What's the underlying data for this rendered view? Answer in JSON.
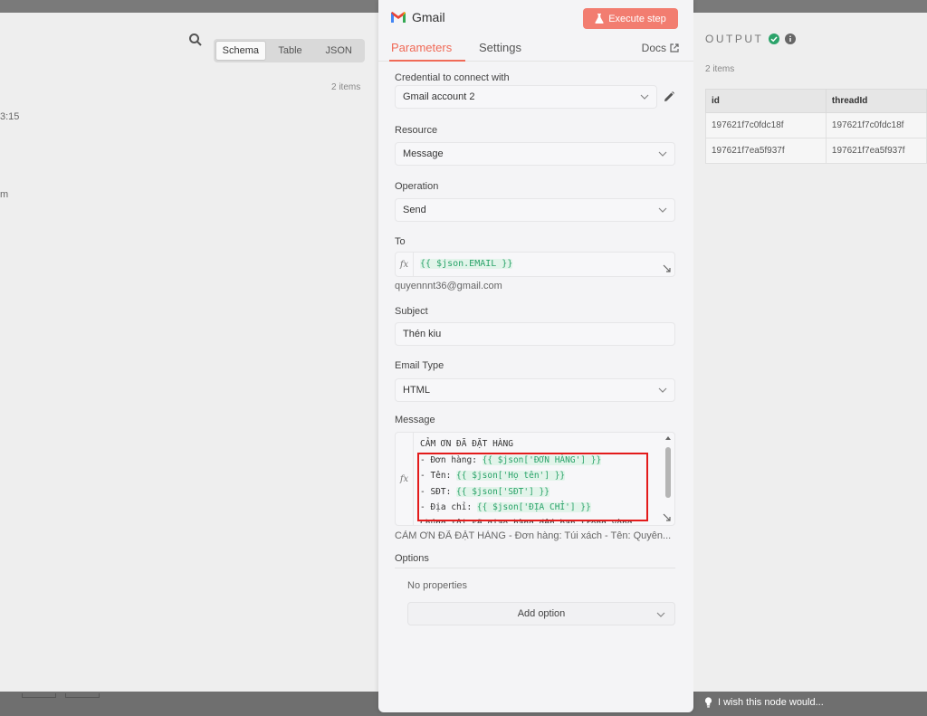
{
  "left_panel": {
    "view_tabs": [
      "Schema",
      "Table",
      "JSON"
    ],
    "active_view": "Schema",
    "item_count": "2 items",
    "fragment_1": "3:15",
    "fragment_2": "m"
  },
  "node": {
    "title": "Gmail",
    "icon": "gmail-icon",
    "execute_label": "Execute step",
    "tabs": {
      "parameters": "Parameters",
      "settings": "Settings"
    },
    "docs_label": "Docs",
    "accent_color": "#f06a57"
  },
  "params": {
    "credential": {
      "label": "Credential to connect with",
      "value": "Gmail account 2"
    },
    "resource": {
      "label": "Resource",
      "value": "Message"
    },
    "operation": {
      "label": "Operation",
      "value": "Send"
    },
    "to": {
      "label": "To",
      "expression": "{{ $json.EMAIL }}",
      "preview": "quyennnt36@gmail.com"
    },
    "subject": {
      "label": "Subject",
      "value": "Thén kiu"
    },
    "email_type": {
      "label": "Email Type",
      "value": "HTML"
    },
    "message": {
      "label": "Message",
      "line1": "CẢM ƠN ĐÃ ĐẶT HÀNG",
      "line2_prefix": "- Đơn hàng: ",
      "line2_token": "{{ $json['ĐƠN HÀNG'] }}",
      "line3_prefix": "- Tên: ",
      "line3_token": "{{ $json['Họ tên'] }}",
      "line4_prefix": "- SĐT: ",
      "line4_token": "{{ $json['SĐT'] }}",
      "line5_prefix": "- Địa chỉ: ",
      "line5_token": "{{ $json['ĐỊA CHỈ'] }}",
      "line6": "Chúng tôi sẽ giao hàng đến bạn trong vòng",
      "preview": "CẢM ƠN ĐÃ ĐẶT HÀNG  - Đơn hàng: Túi xách - Tên: Quyên..."
    },
    "options": {
      "label": "Options",
      "empty": "No properties",
      "add_label": "Add option"
    }
  },
  "output": {
    "title": "OUTPUT",
    "item_count": "2 items",
    "columns": [
      "id",
      "threadId"
    ],
    "rows": [
      [
        "197621f7c0fdc18f",
        "197621f7c0fdc18f"
      ],
      [
        "197621f7ea5f937f",
        "197621f7ea5f937f"
      ]
    ],
    "feedback_label": "I wish this node would..."
  }
}
